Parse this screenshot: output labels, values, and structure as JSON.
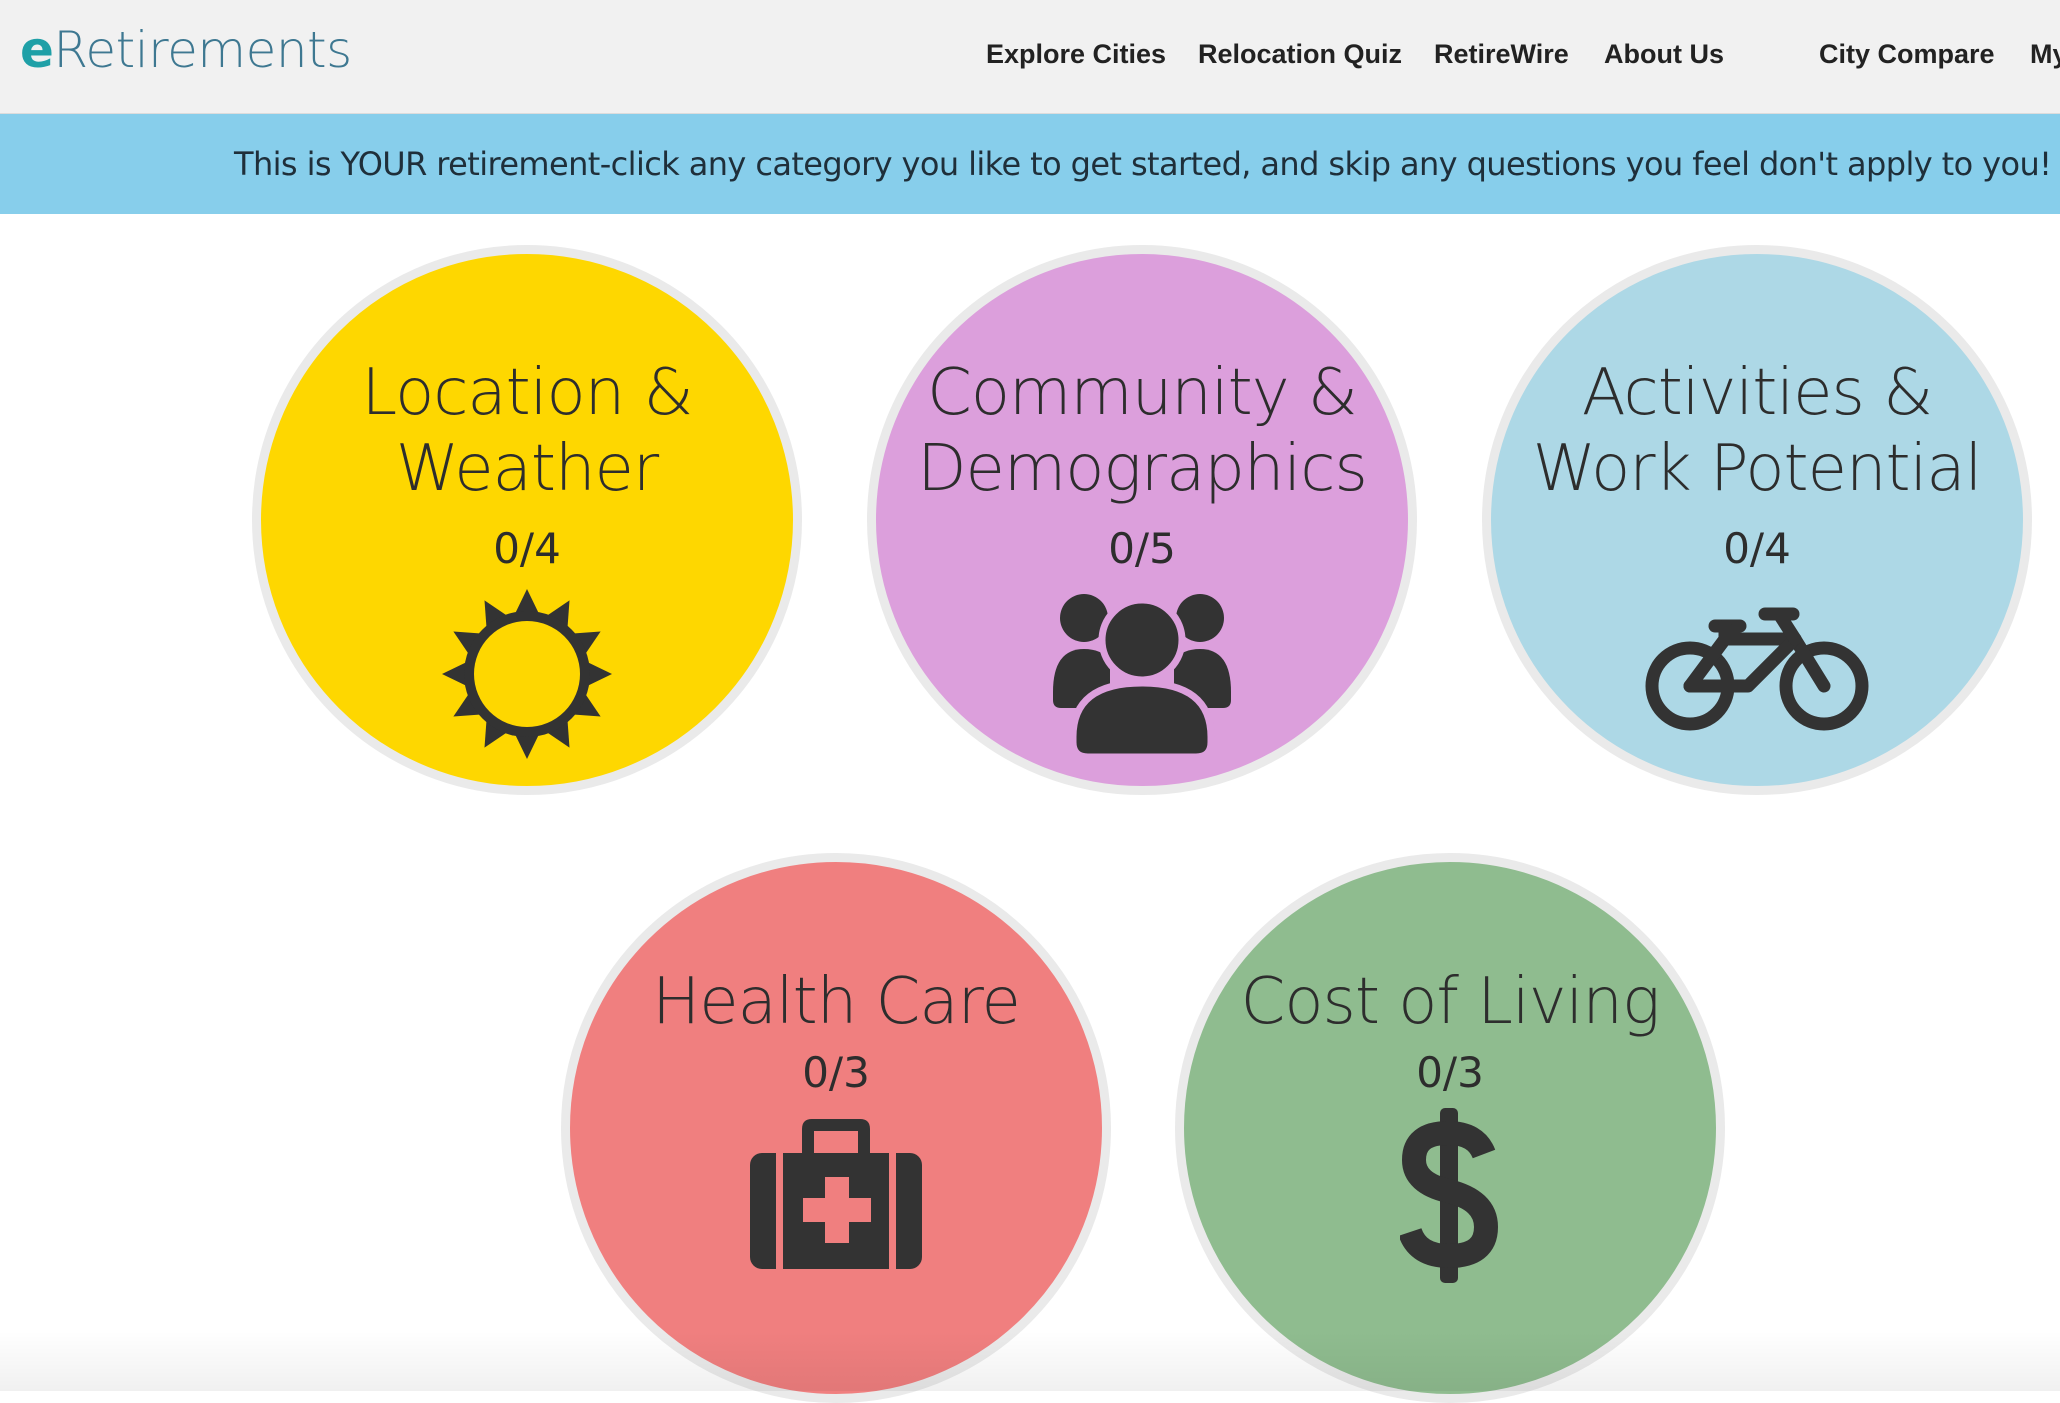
{
  "header": {
    "logo_e": "e",
    "logo_rest": "Retirements",
    "nav": [
      {
        "label": "Explore Cities"
      },
      {
        "label": "Relocation Quiz"
      },
      {
        "label": "RetireWire"
      },
      {
        "label": "About Us"
      },
      {
        "label": "City Compare"
      },
      {
        "label": "My"
      }
    ]
  },
  "banner": {
    "text": "This is YOUR retirement-click any category you like to get started, and skip any questions you feel don't apply to you!"
  },
  "categories": [
    {
      "title_line1": "Location &",
      "title_line2": "Weather",
      "count": "0/4",
      "color": "#fed700",
      "icon": "sun-icon"
    },
    {
      "title_line1": "Community &",
      "title_line2": "Demographics",
      "count": "0/5",
      "color": "#dc9fdc",
      "icon": "people-icon"
    },
    {
      "title_line1": "Activities &",
      "title_line2": "Work Potential",
      "count": "0/4",
      "color": "#add8e6",
      "icon": "bicycle-icon"
    },
    {
      "title_line1": "Health Care",
      "count": "0/3",
      "color": "#f07f7f",
      "icon": "medical-kit-icon"
    },
    {
      "title_line1": "Cost of Living",
      "count": "0/3",
      "color": "#8fbc8f",
      "icon": "dollar-icon"
    }
  ],
  "colors": {
    "banner": "#87ceeb",
    "header_bg": "#f1f1f1",
    "logo_accent": "#1fa0a7",
    "logo_text": "#3e7891",
    "icon": "#333333"
  }
}
